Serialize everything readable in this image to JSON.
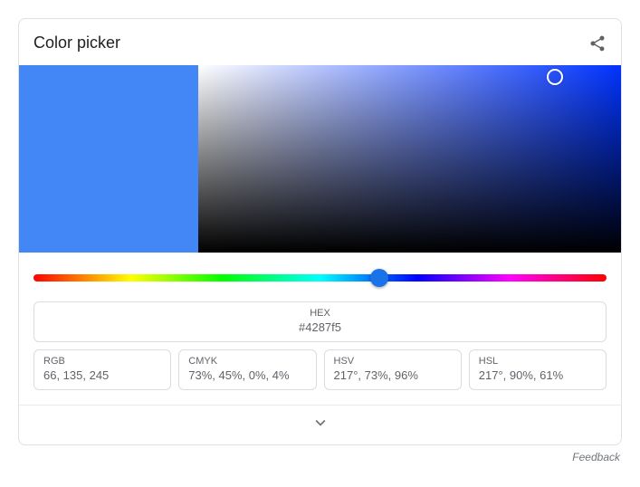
{
  "title": "Color picker",
  "selected_color": "#4287f5",
  "hex": {
    "label": "HEX",
    "value": "#4287f5"
  },
  "formats": [
    {
      "label": "RGB",
      "value": "66, 135, 245"
    },
    {
      "label": "CMYK",
      "value": "73%, 45%, 0%, 4%"
    },
    {
      "label": "HSV",
      "value": "217°, 73%, 96%"
    },
    {
      "label": "HSL",
      "value": "217°, 90%, 61%"
    }
  ],
  "feedback": "Feedback"
}
